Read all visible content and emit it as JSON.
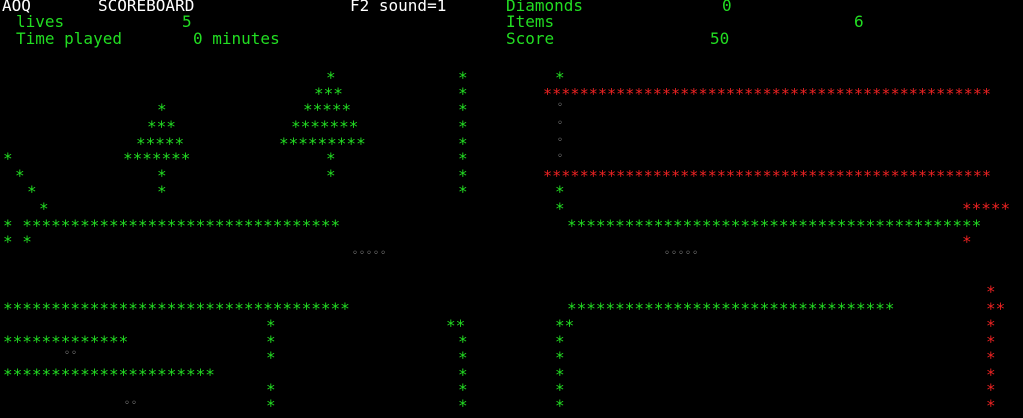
{
  "header": {
    "game_name": "AOQ",
    "title": "SCOREBOARD",
    "sound_text": "F2 sound=1",
    "lives_label": "lives",
    "lives_value": "5",
    "time_label": "Time played",
    "time_value": "0 minutes",
    "diamonds_label": "Diamonds",
    "diamonds_value": "0",
    "items_label": "Items",
    "items_value": "6",
    "score_label": "Score",
    "score_value": "50"
  },
  "colors": {
    "background": "#000000",
    "wall": "#22dd22",
    "hazard": "#ee2222",
    "header_text": "#ffffff",
    "gem": "#bbbbbb"
  },
  "left_map": {
    "tree_left_rows": [
      "*",
      "***",
      "*****",
      "*******",
      "*",
      "*"
    ],
    "tree_right_rows": [
      "*",
      "***",
      "*****",
      "*******",
      "*********",
      "*",
      "*"
    ],
    "slope": [
      "*",
      "*",
      "*",
      "*"
    ],
    "right_wall_rows": [
      "*",
      "*",
      "*",
      "*",
      "*",
      "*",
      "*",
      "*"
    ],
    "upper_floor": "* *********************************",
    "below_floor_markers": "* *",
    "gems_row": "◦◦◦◦◦",
    "lower_ceiling": "************************************",
    "lower_ledge_1": "*************",
    "lower_gems_1": "◦◦",
    "lower_ledge_2": "**********************",
    "lower_gems_2": "◦◦",
    "pillar_rows": [
      "*",
      "*",
      "*",
      "*",
      "*",
      "*"
    ],
    "right_corner": "**",
    "right_pillar_rows": [
      "*",
      "*",
      "*",
      "*",
      "*"
    ]
  },
  "right_map": {
    "top_marker": "*",
    "red_band_top": "*************************************************",
    "vertical_gems": [
      "◦",
      "◦",
      "◦",
      "◦"
    ],
    "red_band_bottom": "*************************************************",
    "left_markers": [
      "*",
      "*"
    ],
    "red_ledge": "*****",
    "green_floor": "*******************************************",
    "red_drop": "*",
    "gems_row": "◦◦◦◦◦",
    "red_top_marker": "*",
    "lower_green_ceiling": "**********************************",
    "lower_red_tail": "**",
    "corner_markers": "**",
    "left_wall_rows": [
      "*",
      "*",
      "*",
      "*",
      "*"
    ],
    "red_wall_rows": [
      "*",
      "*",
      "*",
      "*",
      "*",
      "*"
    ]
  }
}
